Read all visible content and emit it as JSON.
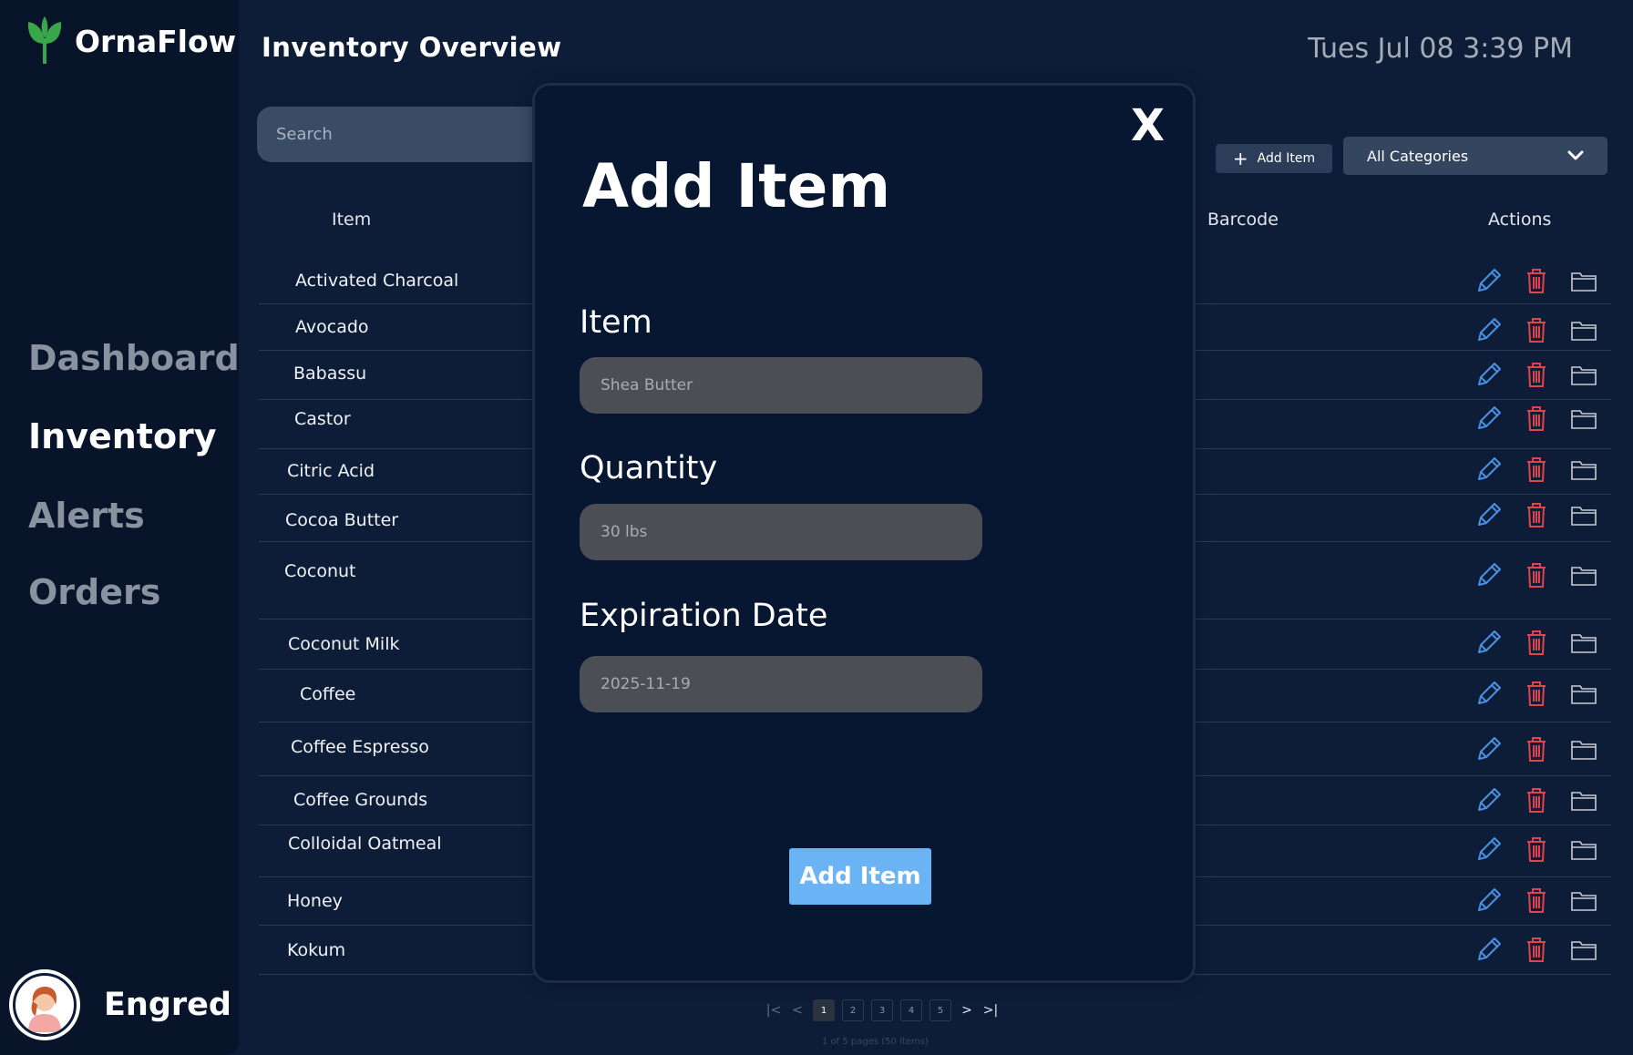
{
  "app": {
    "name": "OrnaFlow"
  },
  "sidebar": {
    "items": [
      {
        "label": "Dashboard",
        "active": false
      },
      {
        "label": "Inventory",
        "active": true
      },
      {
        "label": "Alerts",
        "active": false
      },
      {
        "label": "Orders",
        "active": false
      }
    ],
    "user": {
      "name": "Engred"
    }
  },
  "header": {
    "title": "Inventory Overview",
    "datetime": "Tues Jul 08 3:39 PM"
  },
  "toolbar": {
    "search_placeholder": "Search",
    "add_label": "Add Item",
    "category_selected": "All Categories"
  },
  "table": {
    "columns": {
      "item": "Item",
      "barcode": "Barcode",
      "actions": "Actions"
    },
    "rows": [
      "Activated Charcoal",
      "Avocado",
      "Babassu",
      "Castor",
      "Citric Acid",
      "Cocoa Butter",
      "Coconut",
      "Coconut Milk",
      "Coffee",
      "Coffee Espresso",
      "Coffee Grounds",
      "Colloidal Oatmeal",
      "Honey",
      "Kokum"
    ]
  },
  "pagination": {
    "pages": [
      "1",
      "2",
      "3",
      "4",
      "5"
    ],
    "current": "1",
    "info": "1 of 5 pages (50 items)"
  },
  "modal": {
    "title": "Add Item",
    "close_label": "X",
    "fields": {
      "item": {
        "label": "Item",
        "placeholder": "Shea Butter"
      },
      "quantity": {
        "label": "Quantity",
        "placeholder": "30 lbs"
      },
      "expiration": {
        "label": "Expiration Date",
        "placeholder": "2025-11-19"
      }
    },
    "submit_label": "Add Item"
  },
  "colors": {
    "background": "#0d1d38",
    "sidebar": "#07142a",
    "accent": "#6ab4f5",
    "edit_icon": "#4a90e2",
    "delete_icon": "#e0434b",
    "brand_leaf": "#3aa64a"
  },
  "icons": {
    "logo": "leaf-sprout-icon",
    "edit": "pencil-icon",
    "delete": "trash-icon",
    "folder": "folder-icon",
    "dropdown": "chevron-down-icon",
    "add": "plus-icon"
  }
}
